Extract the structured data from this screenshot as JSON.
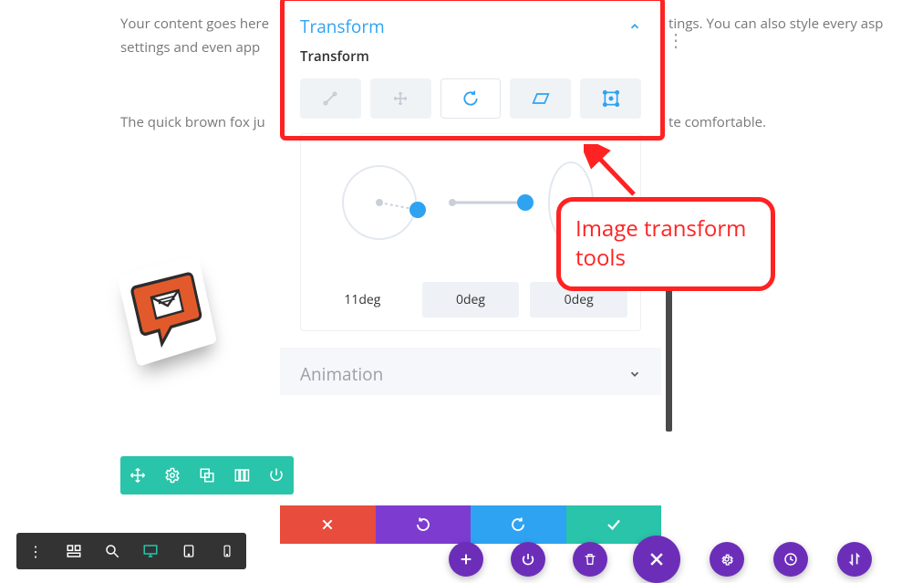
{
  "background_text": {
    "line1": "Your content goes here",
    "line2": "settings and even app",
    "line3": "tings. You can also style every asp",
    "line4": "The quick brown fox ju",
    "line5": "te comfortable."
  },
  "panel": {
    "section_title": "Transform",
    "sub_label": "Transform",
    "animation_title": "Animation",
    "tools": [
      "scale",
      "move",
      "rotate",
      "skew",
      "origin"
    ],
    "active_tool_index": 2,
    "degrees": {
      "x": "11deg",
      "y": "0deg",
      "z": "0deg"
    }
  },
  "action_bar": {
    "close": "close",
    "undo": "undo",
    "redo": "redo",
    "confirm": "confirm"
  },
  "callout": {
    "text": "Image transform tools"
  },
  "colors": {
    "primary_blue": "#2ea3f2",
    "highlight_red": "#ff2222",
    "green": "#29c4a9",
    "purple": "#6c2eb9"
  }
}
